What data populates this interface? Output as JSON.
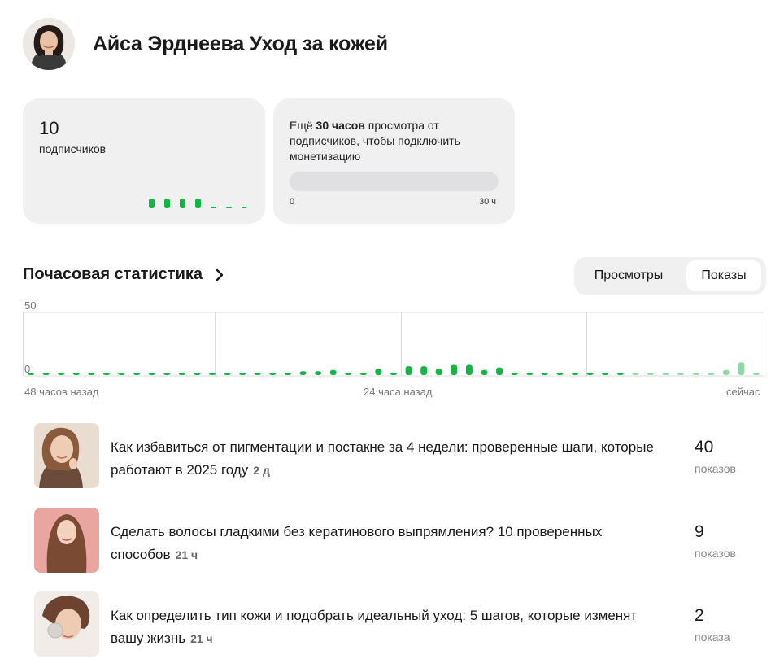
{
  "channel": {
    "title": "Айса Эрднеева Уход за кожей"
  },
  "subscribers": {
    "count": "10",
    "label": "подписчиков",
    "trend": [
      1,
      1,
      1,
      1,
      0,
      0,
      0
    ]
  },
  "monetization": {
    "text_prefix": "Ещё ",
    "text_bold": "30 часов",
    "text_suffix": " просмотра от подписчиков, чтобы подключить монетизацию",
    "progress_min": "0",
    "progress_max": "30 ч",
    "progress_value": 0
  },
  "hourly": {
    "title": "Почасовая статистика",
    "toggle_views": "Просмотры",
    "toggle_shows": "Показы",
    "active_toggle": "Показы",
    "x_labels": [
      "48 часов назад",
      "24 часа назад",
      "сейчас"
    ]
  },
  "chart_data": {
    "type": "bar",
    "ylim": [
      0,
      50
    ],
    "yticks": [
      "50",
      "0"
    ],
    "values": [
      1,
      1,
      1,
      1,
      1,
      1,
      1,
      1,
      1,
      1,
      1,
      1,
      1,
      1,
      1,
      1,
      1,
      1,
      3,
      3,
      4,
      2,
      2,
      5,
      2,
      7,
      7,
      5,
      8,
      8,
      4,
      6,
      2,
      1,
      1,
      1,
      1,
      1,
      1,
      1,
      1,
      1,
      1,
      1,
      1,
      1,
      4,
      10,
      2
    ],
    "recent_count": 9,
    "colors": {
      "bar": "#14b545",
      "bar_recent": "#8fd9a8",
      "grid": "#dcdcdc"
    }
  },
  "posts": [
    {
      "title": "Как избавиться от пигментации и постакне за 4 недели: проверенные шаги, которые работают в 2025 году",
      "age": "2 д",
      "count": "40",
      "unit": "показов"
    },
    {
      "title": "Сделать волосы гладкими без кератинового выпрямления? 10 проверенных способов",
      "age": "21 ч",
      "count": "9",
      "unit": "показов"
    },
    {
      "title": "Как определить тип кожи и подобрать идеальный уход: 5 шагов, которые изменят вашу жизнь",
      "age": "21 ч",
      "count": "2",
      "unit": "показа"
    }
  ]
}
